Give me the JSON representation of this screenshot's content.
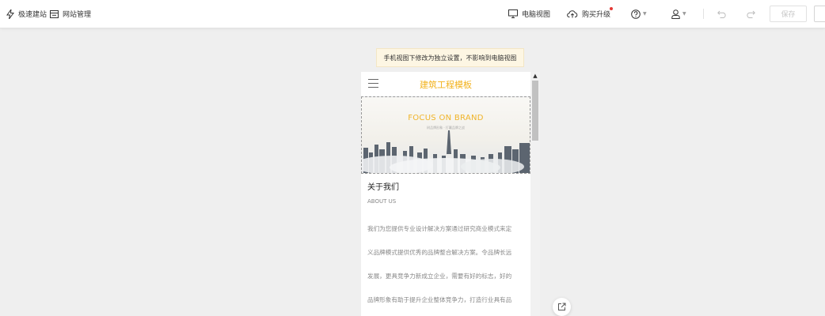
{
  "toolbar": {
    "quick_build_label": "极速建站",
    "site_manage_label": "网站管理",
    "desktop_view_label": "电脑视图",
    "upgrade_label": "购买升级",
    "save_label": "保存"
  },
  "notice": {
    "text": "手机视图下修改为独立设置，不影响到电脑视图"
  },
  "mobile": {
    "site_title": "建筑工程模板",
    "banner": {
      "title": "FOCUS ON BRAND",
      "subtitle": "树品牌形象 · 打赢品牌之战"
    },
    "about": {
      "title": "关于我们",
      "subtitle": "ABOUT US",
      "lines": [
        "我们为您提供专业设计解决方案通过研究商业模式来定",
        "义品牌模式提供优秀的品牌整合解决方案。令品牌长远",
        "发展，更具竞争力新成立企业，需要有好的标志，好的",
        "品牌形象有助于提升企业整体竞争力，打造行业具有品"
      ]
    }
  },
  "colors": {
    "accent": "#f2b21c",
    "badge": "#e53935",
    "notice_bg": "#fdf6e3"
  }
}
